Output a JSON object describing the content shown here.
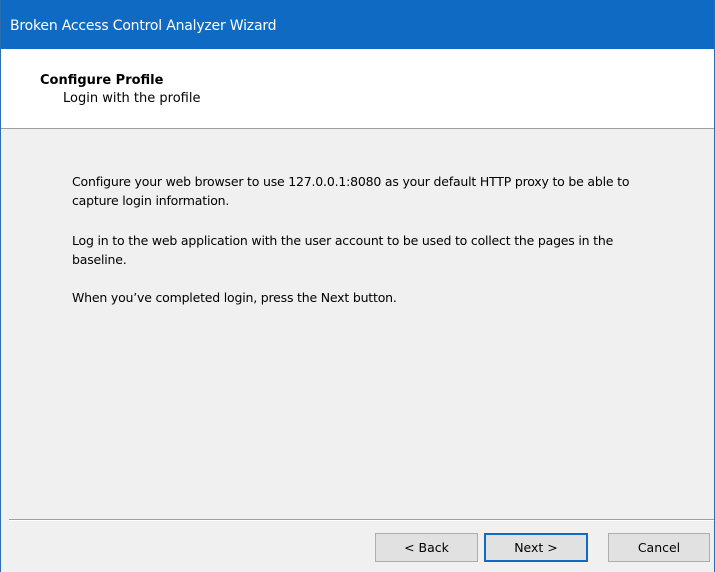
{
  "window": {
    "title": "Broken Access Control Analyzer Wizard"
  },
  "header": {
    "title": "Configure Profile",
    "subtitle": "Login with the profile"
  },
  "content": {
    "paragraphs": [
      "Configure your web browser to use 127.0.0.1:8080 as your default HTTP proxy to be able to capture login information.",
      "Log in to the web application with the user account to be used to collect the pages in the baseline.",
      "When you’ve completed login, press the Next button."
    ]
  },
  "buttons": {
    "back": "< Back",
    "next": "Next >",
    "cancel": "Cancel"
  },
  "colors": {
    "titlebar": "#0f6ac4",
    "default_button_border": "#0f6ac4"
  }
}
